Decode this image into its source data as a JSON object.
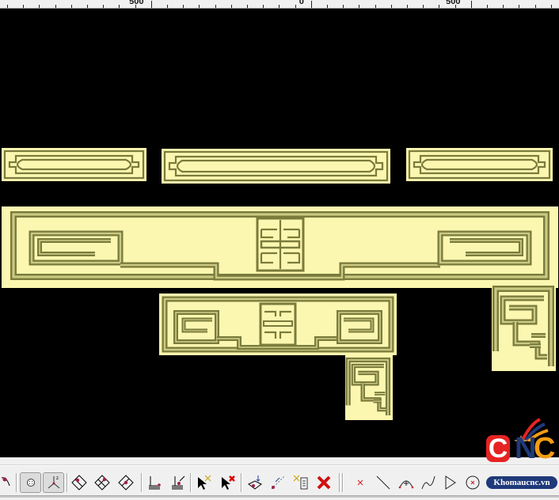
{
  "ruler": {
    "labels": [
      "500",
      "0",
      "500"
    ]
  },
  "canvas": {
    "background": "#000000",
    "relief_fill": "#fbf7b0",
    "relief_groove": "#7b7b3c"
  },
  "toolbar": {
    "buttons": [
      {
        "icon": "draw-curve-node-icon",
        "pressed": false
      },
      {
        "icon": "snap-grid-icon",
        "pressed": true
      },
      {
        "icon": "axes-xyz-icon",
        "pressed": true
      },
      {
        "icon": "view-plane-top-left-icon",
        "pressed": false
      },
      {
        "icon": "view-plane-top-right-icon",
        "pressed": false
      },
      {
        "icon": "view-plane-center-icon",
        "pressed": false
      },
      {
        "icon": "layer-node-icon",
        "pressed": false
      },
      {
        "icon": "layer-import-icon",
        "pressed": false
      },
      {
        "icon": "select-node-icon",
        "pressed": false
      },
      {
        "icon": "select-delete-icon",
        "pressed": false
      },
      {
        "icon": "project-down-icon",
        "pressed": false
      },
      {
        "icon": "project-to-line-icon",
        "pressed": false
      },
      {
        "icon": "node-list-icon",
        "pressed": false
      },
      {
        "icon": "delete-icon",
        "pressed": false
      },
      {
        "icon": "point-icon",
        "pressed": false
      },
      {
        "icon": "line-icon",
        "pressed": false
      },
      {
        "icon": "arc-icon",
        "pressed": false
      },
      {
        "icon": "spline-icon",
        "pressed": false
      },
      {
        "icon": "polyline-icon",
        "pressed": false
      },
      {
        "icon": "circle-point-icon",
        "pressed": false
      }
    ]
  },
  "logo": {
    "letters": [
      "C",
      "N",
      "C"
    ],
    "badge": "Khomaucnc.vn",
    "colors": {
      "red": "#e52322",
      "blue": "#1f3a7a",
      "orange": "#f39c12"
    }
  }
}
